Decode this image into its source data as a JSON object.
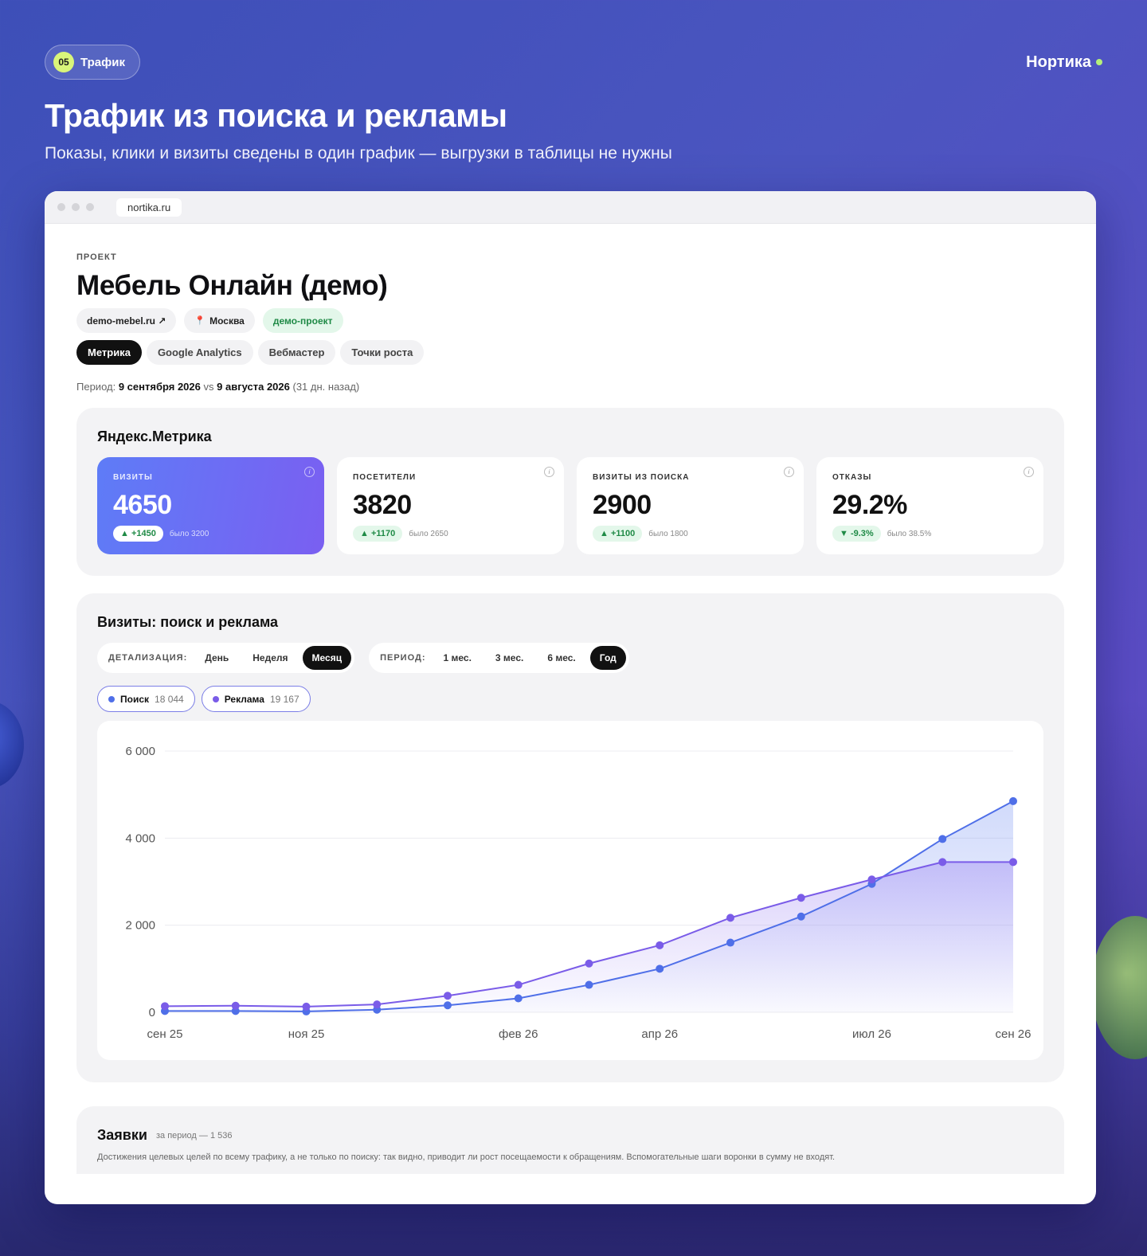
{
  "badge": {
    "number": "05",
    "label": "Трафик"
  },
  "brand": "Нортика",
  "headline": "Трафик из поиска и рекламы",
  "subline": "Показы, клики и визиты сведены в один график — выгрузки в таблицы не нужны",
  "browser": {
    "url": "nortika.ru"
  },
  "project": {
    "label": "ПРОЕКТ",
    "title": "Мебель Онлайн (демо)",
    "tags": {
      "site": "demo-mebel.ru ↗",
      "city": "Москва",
      "status": "демо-проект"
    },
    "tabs": [
      "Метрика",
      "Google Analytics",
      "Вебмастер",
      "Точки роста"
    ],
    "active_tab": "Метрика",
    "period": {
      "prefix": "Период:",
      "current": "9 сентября 2026",
      "vs": "vs",
      "previous": "9 августа 2026",
      "note": "(31 дн. назад)"
    }
  },
  "metrica": {
    "title": "Яндекс.Метрика",
    "kpis": [
      {
        "label": "ВИЗИТЫ",
        "value": "4650",
        "delta": "▲ +1450",
        "was": "было 3200"
      },
      {
        "label": "ПОСЕТИТЕЛИ",
        "value": "3820",
        "delta": "▲ +1170",
        "was": "было 2650"
      },
      {
        "label": "ВИЗИТЫ ИЗ ПОИСКА",
        "value": "2900",
        "delta": "▲ +1100",
        "was": "было 1800"
      },
      {
        "label": "ОТКАЗЫ",
        "value": "29.2%",
        "delta": "▼ -9.3%",
        "was": "было 38.5%"
      }
    ]
  },
  "visits_chart": {
    "title": "Визиты: поиск и реклама",
    "detail": {
      "label": "ДЕТАЛИЗАЦИЯ:",
      "options": [
        "День",
        "Неделя",
        "Месяц"
      ],
      "active": "Месяц"
    },
    "period": {
      "label": "ПЕРИОД:",
      "options": [
        "1 мес.",
        "3 мес.",
        "6 мес.",
        "Год"
      ],
      "active": "Год"
    },
    "legend": [
      {
        "name": "Поиск",
        "total": "18 044",
        "color": "#4f6fe8"
      },
      {
        "name": "Реклама",
        "total": "19 167",
        "color": "#7a5ce8"
      }
    ]
  },
  "chart_data": {
    "type": "line",
    "x": [
      "сен 25",
      "окт 25",
      "ноя 25",
      "дек 25",
      "янв 26",
      "фев 26",
      "мар 26",
      "апр 26",
      "май 26",
      "июн 26",
      "июл 26",
      "авг 26",
      "сен 26"
    ],
    "x_tick_labels": [
      "сен 25",
      "ноя 25",
      "фев 26",
      "апр 26",
      "июл 26",
      "сен 26"
    ],
    "series": [
      {
        "name": "Поиск",
        "color": "#4f6fe8",
        "values": [
          30,
          30,
          20,
          60,
          160,
          320,
          630,
          1000,
          1600,
          2200,
          2950,
          3980,
          4850
        ]
      },
      {
        "name": "Реклама",
        "color": "#7a5ce8",
        "values": [
          140,
          150,
          130,
          180,
          380,
          630,
          1120,
          1540,
          2170,
          2630,
          3050,
          3450,
          3450
        ]
      }
    ],
    "ylim": [
      0,
      6000
    ],
    "yticks": [
      0,
      2000,
      4000,
      6000
    ],
    "ytick_labels": [
      "0",
      "2 000",
      "4 000",
      "6 000"
    ],
    "grid": true
  },
  "leads": {
    "title": "Заявки",
    "subtitle": "за период — 1 536",
    "description": "Достижения целевых целей по всему трафику, а не только по поиску: так видно, приводит ли рост посещаемости к обращениям. Вспомогательные шаги воронки в сумму не входят."
  }
}
